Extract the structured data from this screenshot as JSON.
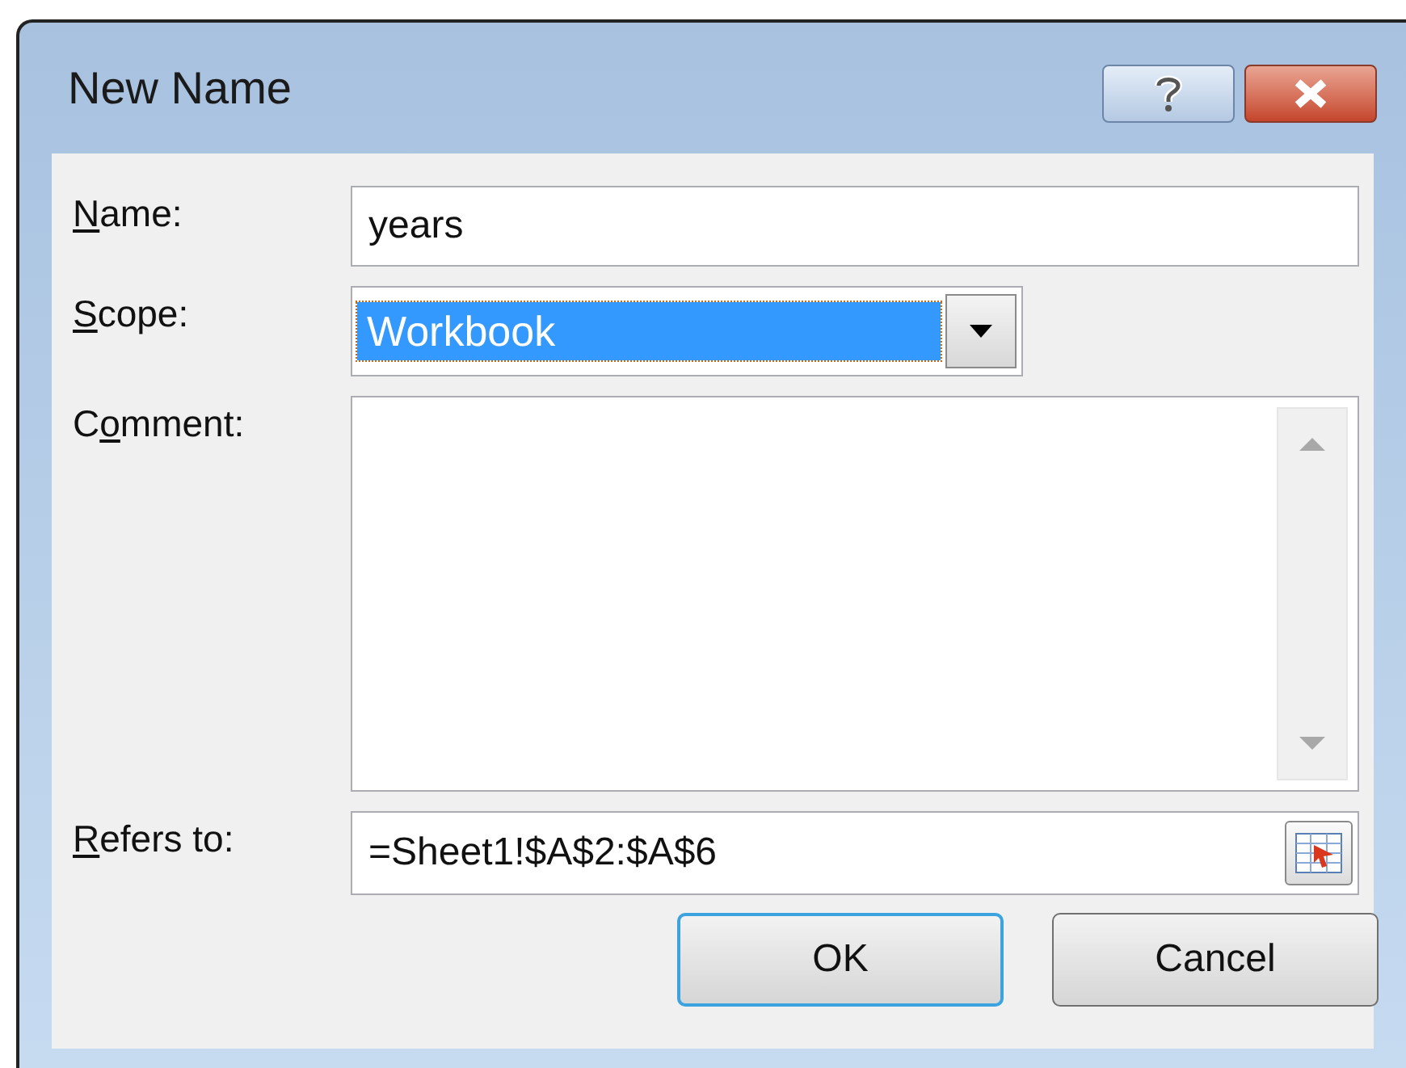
{
  "window": {
    "title": "New Name"
  },
  "fields": [
    {
      "kind": "text",
      "access_key": "N",
      "label_rest": "ame:",
      "value": "years"
    },
    {
      "kind": "dropdown",
      "access_key": "S",
      "label_rest": "cope:",
      "value": "Workbook",
      "selected": true
    },
    {
      "kind": "textarea",
      "label_start": "C",
      "access_key": "o",
      "label_rest": "mment:"
    },
    {
      "kind": "reference",
      "access_key": "R",
      "label_rest": "efers to:",
      "value": "=Sheet1!$A$2:$A$6"
    }
  ],
  "buttons": [
    {
      "label": "OK",
      "default": true
    },
    {
      "label": "Cancel",
      "default": false
    }
  ]
}
